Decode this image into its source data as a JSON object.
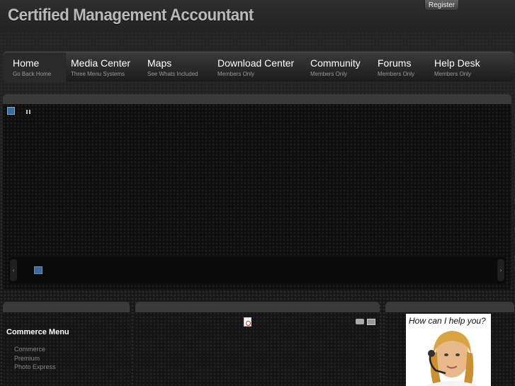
{
  "header": {
    "site_title": "Certified Management Accountant",
    "register_label": "Register"
  },
  "nav": {
    "items": [
      {
        "title": "Home",
        "subtitle": "Go Back Home"
      },
      {
        "title": "Media Center",
        "subtitle": "Three Menu Systems"
      },
      {
        "title": "Maps",
        "subtitle": "See Whats Included"
      },
      {
        "title": "Download Center",
        "subtitle": "Members Only"
      },
      {
        "title": "Community",
        "subtitle": "Members Only"
      },
      {
        "title": "Forums",
        "subtitle": "Members Only"
      },
      {
        "title": "Help Desk",
        "subtitle": "Members Only"
      }
    ]
  },
  "slider": {
    "prev_glyph": "‹",
    "next_glyph": "›"
  },
  "commerce": {
    "title": "Commerce Menu",
    "links": [
      "Commerce",
      "Premium",
      "Photo Express"
    ]
  },
  "help": {
    "text": "How can I help you?"
  }
}
